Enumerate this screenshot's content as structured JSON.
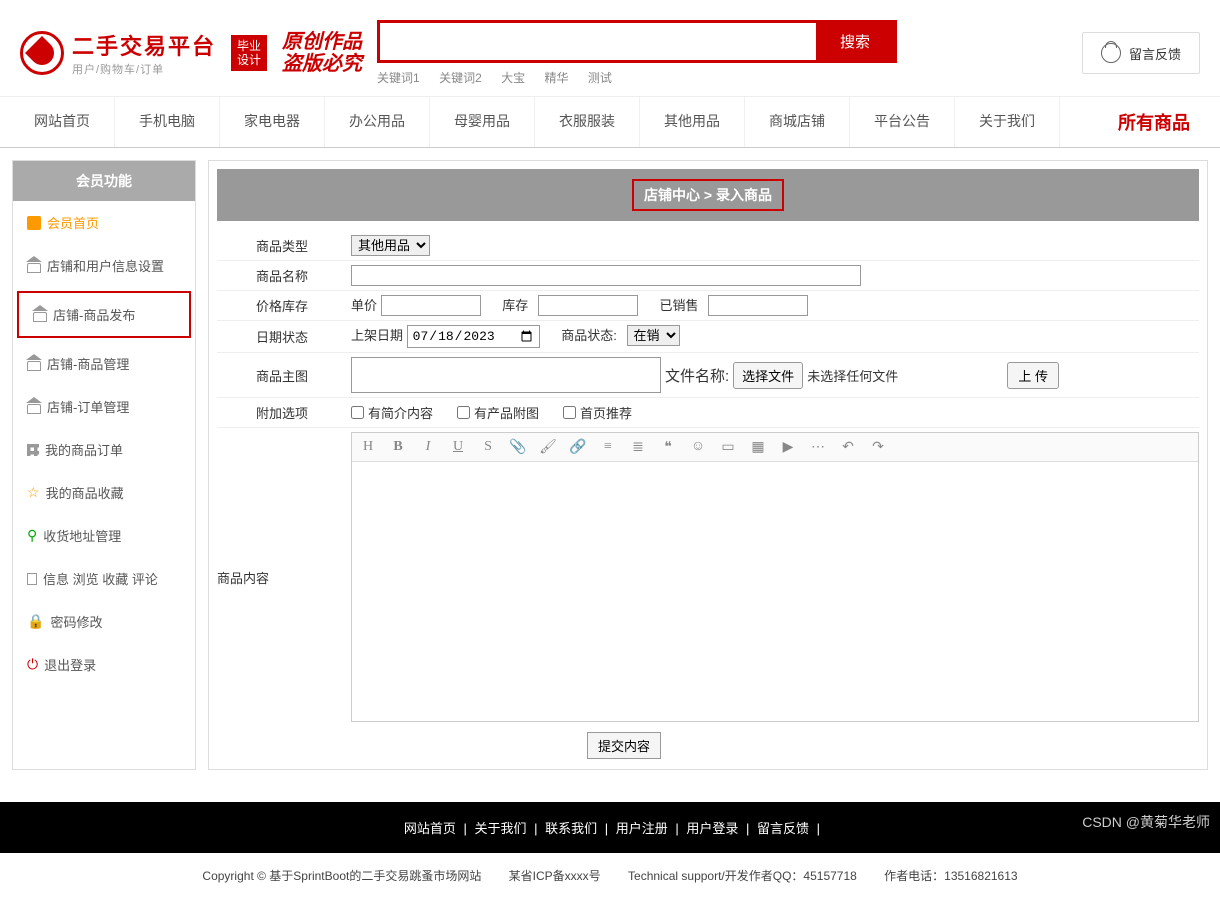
{
  "header": {
    "logo_title": "二手交易平台",
    "logo_sub": "用户/购物车/订单",
    "badge_line1": "毕业",
    "badge_line2": "设计",
    "calli_line1": "原创作品",
    "calli_line2": "盗版必究",
    "search_placeholder": "",
    "search_btn": "搜索",
    "keywords": [
      "关键词1",
      "关键词2",
      "大宝",
      "精华",
      "测试"
    ],
    "feedback": "留言反馈"
  },
  "nav": {
    "items": [
      "网站首页",
      "手机电脑",
      "家电电器",
      "办公用品",
      "母婴用品",
      "衣服服装",
      "其他用品",
      "商城店铺",
      "平台公告",
      "关于我们"
    ],
    "all": "所有商品"
  },
  "sidebar": {
    "title": "会员功能",
    "items": [
      {
        "label": "会员首页",
        "icon": "home"
      },
      {
        "label": "店铺和用户信息设置",
        "icon": "house"
      },
      {
        "label": "店铺-商品发布",
        "icon": "house",
        "highlight": true
      },
      {
        "label": "店铺-商品管理",
        "icon": "house"
      },
      {
        "label": "店铺-订单管理",
        "icon": "house"
      },
      {
        "label": "我的商品订单",
        "icon": "grid"
      },
      {
        "label": "我的商品收藏",
        "icon": "star"
      },
      {
        "label": "收货地址管理",
        "icon": "pin"
      },
      {
        "label": "信息 浏览 收藏 评论",
        "icon": "doc"
      },
      {
        "label": "密码修改",
        "icon": "lock"
      },
      {
        "label": "退出登录",
        "icon": "power"
      }
    ]
  },
  "breadcrumb": {
    "part1": "店铺中心",
    "sep": ">",
    "part2": "录入商品"
  },
  "form": {
    "labels": {
      "type": "商品类型",
      "name": "商品名称",
      "price_stock": "价格库存",
      "unit_price": "单价",
      "stock": "库存",
      "sold": "已销售",
      "date_status": "日期状态",
      "list_date": "上架日期",
      "product_status": "商品状态:",
      "main_image": "商品主图",
      "file_name": "文件名称:",
      "select_file": "选择文件",
      "no_file": "未选择任何文件",
      "upload": "上 传",
      "extra_options": "附加选项",
      "has_intro": "有简介内容",
      "has_image": "有产品附图",
      "home_rec": "首页推荐",
      "content": "商品内容",
      "submit": "提交内容"
    },
    "type_value": "其他用品",
    "date_value": "2023/07/18",
    "status_value": "在销"
  },
  "footer": {
    "dark_links": [
      "网站首页",
      "关于我们",
      "联系我们",
      "用户注册",
      "用户登录",
      "留言反馈"
    ],
    "copyright": "Copyright © 基于SprintBoot的二手交易跳蚤市场网站",
    "icp": "某省ICP备xxxx号",
    "tech": "Technical support/开发作者QQ：45157718",
    "phone": "作者电话：13516821613"
  },
  "watermark": "CSDN @黄菊华老师"
}
